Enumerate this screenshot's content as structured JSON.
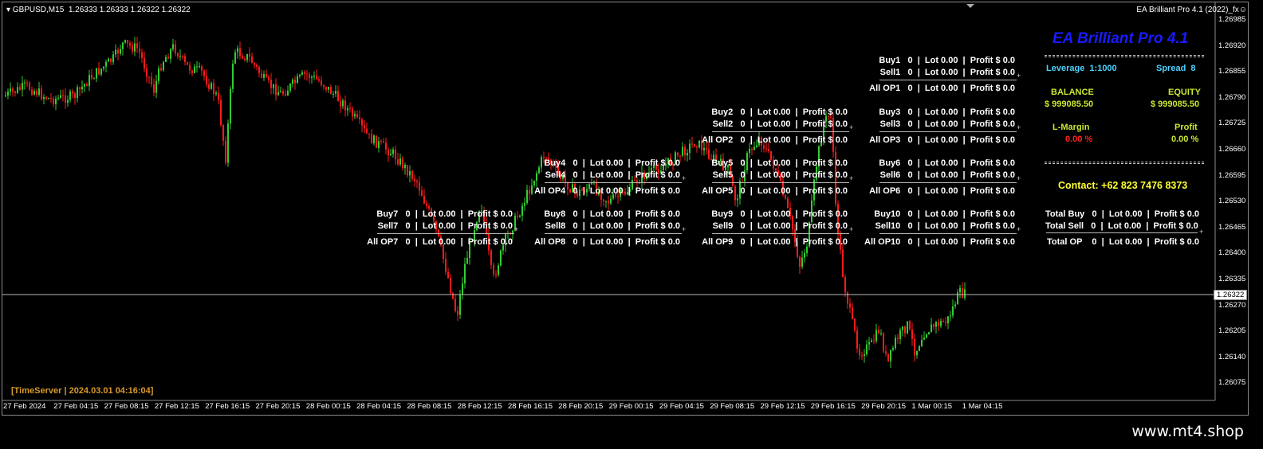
{
  "header": {
    "symbol_line": "▾ GBPUSD,M15  1.26333 1.26333 1.26322 1.26322",
    "ea_name": "EA Brilliant Pro 4.1 (2022)_fx☺"
  },
  "price_axis": [
    "1.26985",
    "1.26920",
    "1.26855",
    "1.26790",
    "1.26725",
    "1.26660",
    "1.26595",
    "1.26530",
    "1.26465",
    "1.26400",
    "1.26335",
    "1.26270",
    "1.26205",
    "1.26140",
    "1.26075"
  ],
  "current_price": "1.26322",
  "time_axis": [
    "27 Feb 2024",
    "27 Feb 04:15",
    "27 Feb 08:15",
    "27 Feb 12:15",
    "27 Feb 16:15",
    "27 Feb 20:15",
    "28 Feb 00:15",
    "28 Feb 04:15",
    "28 Feb 08:15",
    "28 Feb 12:15",
    "28 Feb 16:15",
    "28 Feb 20:15",
    "29 Feb 00:15",
    "29 Feb 04:15",
    "29 Feb 08:15",
    "29 Feb 12:15",
    "29 Feb 16:15",
    "29 Feb 20:15",
    "1 Mar 00:15",
    "1 Mar 04:15"
  ],
  "panel": {
    "title": "EA Brilliant Pro 4.1",
    "leverage_label": "Leverage  1:1000",
    "spread_label": "Spread  8",
    "balance_label": "BALANCE",
    "balance_value": "$ 999085.50",
    "equity_label": "EQUITY",
    "equity_value": "$ 999085.50",
    "lmargin_label": "L-Margin",
    "lmargin_value": "0.00 %",
    "profit_label": "Profit",
    "profit_value": "0.00 %",
    "contact": "Contact: +62 823 7476 8373",
    "total_buy": "Total Buy   0  |  Lot 0.00  |  Profit $ 0.0",
    "total_sell": "Total Sell   0  |  Lot 0.00  |  Profit $ 0.0",
    "total_op": "Total OP    0  |  Lot 0.00  |  Profit $ 0.0"
  },
  "op_blocks": [
    {
      "buy": "Buy1   0  |  Lot 0.00  |  Profit $ 0.0",
      "sell": "Sell1   0  |  Lot 0.00  |  Profit $ 0.0",
      "all": "All OP1   0  |  Lot 0.00  |  Profit $ 0.0"
    },
    {
      "buy": "Buy2   0  |  Lot 0.00  |  Profit $ 0.0",
      "sell": "Sell2   0  |  Lot 0.00  |  Profit $ 0.0",
      "all": "All OP2   0  |  Lot 0.00  |  Profit $ 0.0"
    },
    {
      "buy": "Buy3   0  |  Lot 0.00  |  Profit $ 0.0",
      "sell": "Sell3   0  |  Lot 0.00  |  Profit $ 0.0",
      "all": "All OP3   0  |  Lot 0.00  |  Profit $ 0.0"
    },
    {
      "buy": "Buy4   0  |  Lot 0.00  |  Profit $ 0.0",
      "sell": "Sell4   0  |  Lot 0.00  |  Profit $ 0.0",
      "all": "All OP4   0  |  Lot 0.00  |  Profit $ 0.0"
    },
    {
      "buy": "Buy5   0  |  Lot 0.00  |  Profit $ 0.0",
      "sell": "Sell5   0  |  Lot 0.00  |  Profit $ 0.0",
      "all": "All OP5   0  |  Lot 0.00  |  Profit $ 0.0"
    },
    {
      "buy": "Buy6   0  |  Lot 0.00  |  Profit $ 0.0",
      "sell": "Sell6   0  |  Lot 0.00  |  Profit $ 0.0",
      "all": "All OP6   0  |  Lot 0.00  |  Profit $ 0.0"
    },
    {
      "buy": "Buy7   0  |  Lot 0.00  |  Profit $ 0.0",
      "sell": "Sell7   0  |  Lot 0.00  |  Profit $ 0.0",
      "all": "All OP7   0  |  Lot 0.00  |  Profit $ 0.0"
    },
    {
      "buy": "Buy8   0  |  Lot 0.00  |  Profit $ 0.0",
      "sell": "Sell8   0  |  Lot 0.00  |  Profit $ 0.0",
      "all": "All OP8   0  |  Lot 0.00  |  Profit $ 0.0"
    },
    {
      "buy": "Buy9   0  |  Lot 0.00  |  Profit $ 0.0",
      "sell": "Sell9   0  |  Lot 0.00  |  Profit $ 0.0",
      "all": "All OP9   0  |  Lot 0.00  |  Profit $ 0.0"
    },
    {
      "buy": "Buy10   0  |  Lot 0.00  |  Profit $ 0.0",
      "sell": "Sell10   0  |  Lot 0.00  |  Profit $ 0.0",
      "all": "All OP10   0  |  Lot 0.00  |  Profit $ 0.0"
    }
  ],
  "timeserver": "[TimeServer | 2024.03.01 04:16:04]",
  "watermark": "www.mt4.shop",
  "colors": {
    "bull": "#32cd32",
    "bear": "#ff1a1a",
    "title": "#1a1aff",
    "cyan": "#4dd2ff",
    "yellowgreen": "#c8e832",
    "yellow": "#ffff33",
    "red": "#ff2020",
    "timeserver": "#d89a2a"
  }
}
